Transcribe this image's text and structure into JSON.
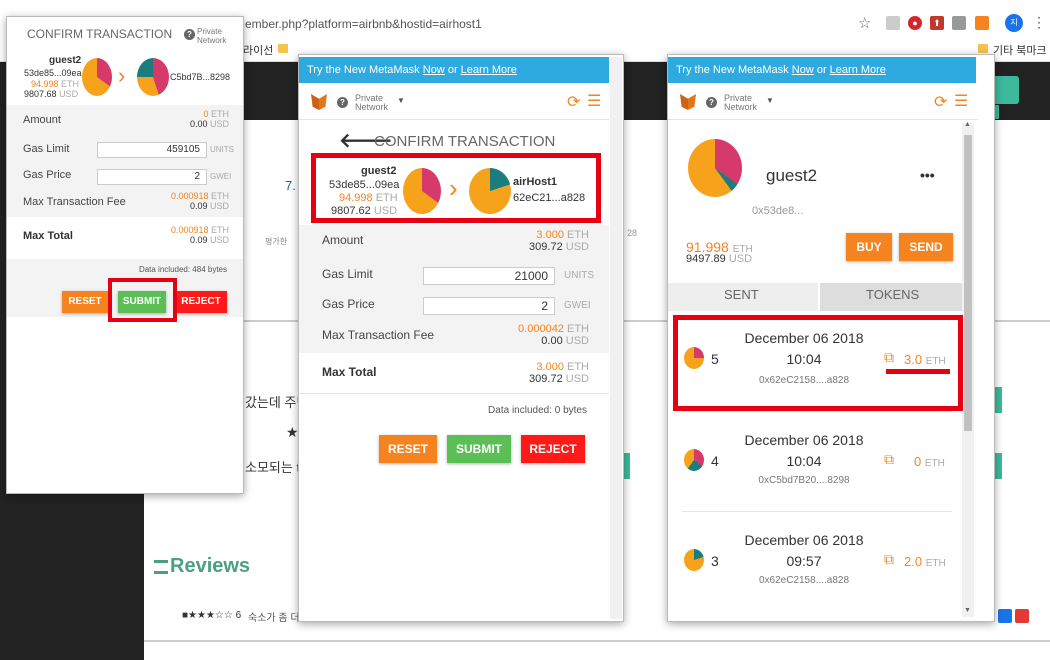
{
  "browser": {
    "url": "ember.php?platform=airbnb&hostid=airhost1",
    "bookmarks": [
      "라이선",
      "기타 북마크"
    ]
  },
  "background": {
    "texts": [
      "7.",
      "갔는데 주변",
      "소모되는 t",
      "평가한",
      "28"
    ],
    "reviews_title": "Reviews",
    "review_line": "숙소가 좀 더"
  },
  "popup1": {
    "title": "CONFIRM TRANSACTION",
    "network": "Private Network",
    "from": {
      "name": "guest2",
      "addr": "53de85...09ea",
      "eth": "94.998",
      "eth_unit": "ETH",
      "usd": "9807.68",
      "usd_unit": "USD"
    },
    "to": {
      "addr": "C5bd7B...8298"
    },
    "rows": [
      {
        "label": "Amount",
        "eth": "0",
        "eth_unit": "ETH",
        "usd": "0.00",
        "usd_unit": "USD"
      },
      {
        "label": "Gas Limit",
        "value": "459105",
        "unit": "UNITS"
      },
      {
        "label": "Gas Price",
        "value": "2",
        "unit": "GWEI"
      },
      {
        "label": "Max Transaction Fee",
        "eth": "0.000918",
        "eth_unit": "ETH",
        "usd": "0.09",
        "usd_unit": "USD"
      },
      {
        "label": "Max Total",
        "eth": "0.000918",
        "eth_unit": "ETH",
        "usd": "0.09",
        "usd_unit": "USD"
      }
    ],
    "data_included": "Data included: 484 bytes",
    "buttons": {
      "reset": "RESET",
      "submit": "SUBMIT",
      "reject": "REJECT"
    }
  },
  "popup2": {
    "banner": {
      "text": "Try the New MetaMask",
      "now": "Now",
      "or": "or",
      "learn": "Learn More"
    },
    "network": "Private Network",
    "title": "CONFIRM TRANSACTION",
    "from": {
      "name": "guest2",
      "addr": "53de85...09ea",
      "eth": "94.998",
      "eth_unit": "ETH",
      "usd": "9807.62",
      "usd_unit": "USD"
    },
    "to": {
      "name": "airHost1",
      "addr": "62eC21...a828"
    },
    "rows": [
      {
        "label": "Amount",
        "eth": "3.000",
        "eth_unit": "ETH",
        "usd": "309.72",
        "usd_unit": "USD"
      },
      {
        "label": "Gas Limit",
        "value": "21000",
        "unit": "UNITS"
      },
      {
        "label": "Gas Price",
        "value": "2",
        "unit": "GWEI"
      },
      {
        "label": "Max Transaction Fee",
        "eth": "0.000042",
        "eth_unit": "ETH",
        "usd": "0.00",
        "usd_unit": "USD"
      },
      {
        "label": "Max Total",
        "eth": "3.000",
        "eth_unit": "ETH",
        "usd": "309.72",
        "usd_unit": "USD"
      }
    ],
    "data_included": "Data included: 0 bytes",
    "buttons": {
      "reset": "RESET",
      "submit": "SUBMIT",
      "reject": "REJECT"
    }
  },
  "popup3": {
    "banner": {
      "text": "Try the New MetaMask",
      "now": "Now",
      "or": "or",
      "learn": "Learn More"
    },
    "network": "Private Network",
    "account": {
      "name": "guest2",
      "addr": "0x53de8...",
      "more": "•••",
      "eth": "91.998",
      "eth_unit": "ETH",
      "usd": "9497.89",
      "usd_unit": "USD"
    },
    "buttons": {
      "buy": "BUY",
      "send": "SEND"
    },
    "tabs": {
      "sent": "SENT",
      "tokens": "TOKENS"
    },
    "transactions": [
      {
        "num": "5",
        "date": "December 06 2018",
        "time": "10:04",
        "addr": "0x62eC2158....a828",
        "amount": "3.0",
        "unit": "ETH"
      },
      {
        "num": "4",
        "date": "December 06 2018",
        "time": "10:04",
        "addr": "0xC5bd7B20....8298",
        "amount": "0",
        "unit": "ETH"
      },
      {
        "num": "3",
        "date": "December 06 2018",
        "time": "09:57",
        "addr": "0x62eC2158....a828",
        "amount": "2.0",
        "unit": "ETH"
      }
    ]
  },
  "colors": {
    "accent_orange": "#f5831f",
    "submit_green": "#5bbf55",
    "reject_red": "#ff1a1a",
    "banner_blue": "#2faae1",
    "highlight_red": "#e60012"
  }
}
